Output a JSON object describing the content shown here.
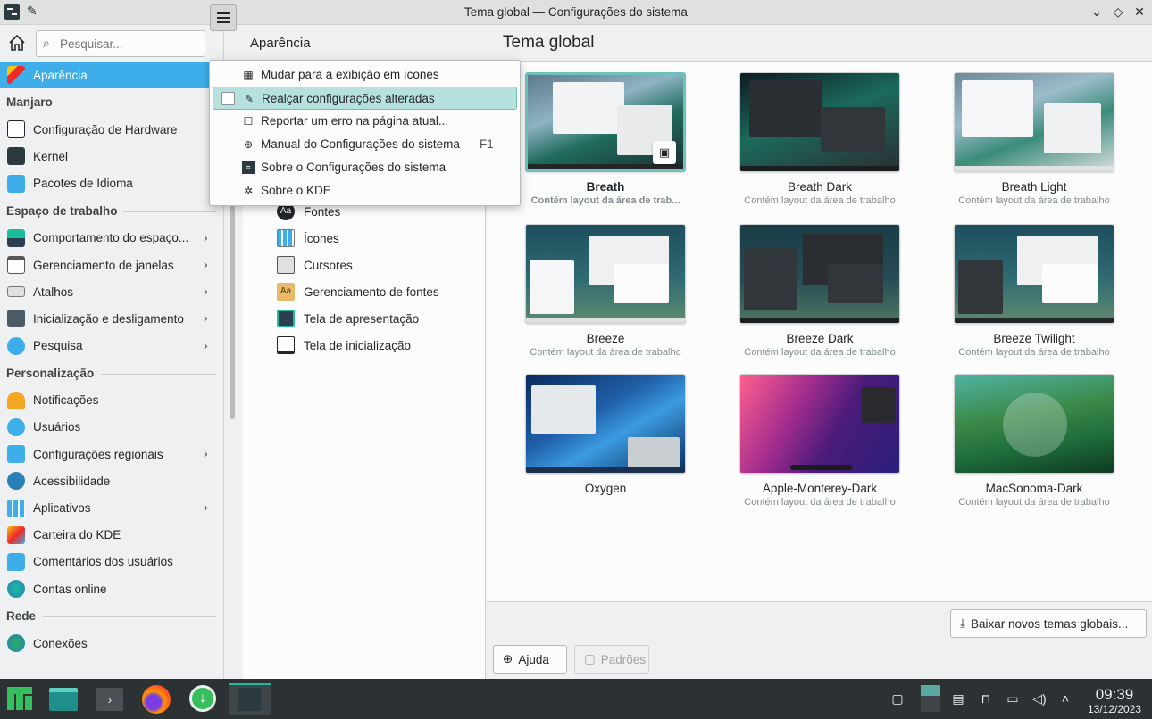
{
  "window": {
    "title": "Tema global — Configurações do sistema",
    "pin_icon": "pin-icon",
    "controls": [
      "chevron-down-icon",
      "diamond-icon",
      "close-icon"
    ]
  },
  "sidebar": {
    "search_placeholder": "Pesquisar...",
    "active_item": "Aparência",
    "groups": [
      {
        "header": "Manjaro",
        "items": [
          "Configuração de Hardware",
          "Kernel",
          "Pacotes de Idioma"
        ]
      },
      {
        "header": "Espaço de trabalho",
        "items": [
          "Comportamento do espaço...",
          "Gerenciamento de janelas",
          "Atalhos",
          "Inicialização e desligamento",
          "Pesquisa"
        ]
      },
      {
        "header": "Personalização",
        "items": [
          "Notificações",
          "Usuários",
          "Configurações regionais",
          "Acessibilidade",
          "Aplicativos",
          "Carteira do KDE",
          "Comentários dos usuários",
          "Contas online"
        ]
      },
      {
        "header": "Rede",
        "items": [
          "Conexões"
        ]
      }
    ]
  },
  "middle": {
    "title": "Aparência",
    "items": [
      "Fontes",
      "Ícones",
      "Cursores",
      "Gerenciamento de fontes",
      "Tela de apresentação",
      "Tela de inicialização"
    ]
  },
  "menu": {
    "items": [
      {
        "label": "Mudar para a exibição em ícones",
        "shortcut": ""
      },
      {
        "label": "Realçar configurações alteradas",
        "shortcut": ""
      },
      {
        "label": "Reportar um erro na página atual...",
        "shortcut": ""
      },
      {
        "label": "Manual do Configurações do sistema",
        "shortcut": "F1"
      },
      {
        "label": "Sobre o Configurações do sistema",
        "shortcut": ""
      },
      {
        "label": "Sobre o KDE",
        "shortcut": ""
      }
    ]
  },
  "main": {
    "title": "Tema global",
    "themes": [
      {
        "name": "Breath",
        "desc": "Contém layout da área de trab...",
        "selected": true
      },
      {
        "name": "Breath Dark",
        "desc": "Contém layout da área de trabalho"
      },
      {
        "name": "Breath Light",
        "desc": "Contém layout da área de trabalho"
      },
      {
        "name": "Breeze",
        "desc": "Contém layout da área de trabalho"
      },
      {
        "name": "Breeze Dark",
        "desc": "Contém layout da área de trabalho"
      },
      {
        "name": "Breeze Twilight",
        "desc": "Contém layout da área de trabalho"
      },
      {
        "name": "Oxygen",
        "desc": ""
      },
      {
        "name": "Apple-Monterey-Dark",
        "desc": "Contém layout da área de trabalho"
      },
      {
        "name": "MacSonoma-Dark",
        "desc": "Contém layout da área de trabalho"
      }
    ],
    "download_label": "Baixar novos temas globais...",
    "help_label": "Ajuda",
    "defaults_label": "Padrões"
  },
  "taskbar": {
    "time": "09:39",
    "date": "13/12/2023"
  },
  "colors": {
    "accent": "#3daee9",
    "selection_teal": "#6ec2bb",
    "taskbar_bg": "#2c3134"
  }
}
